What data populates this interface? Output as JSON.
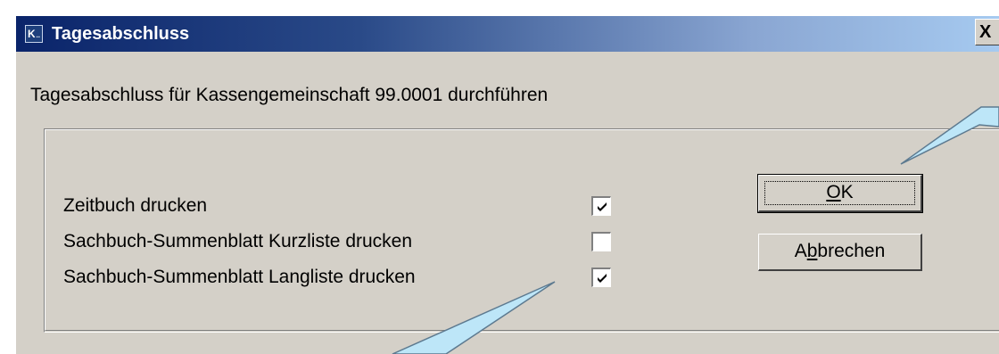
{
  "window": {
    "title": "Tagesabschluss",
    "close_label": "X",
    "icon": {
      "name": "app-icon",
      "glyph": "K",
      "subglyph": ".."
    }
  },
  "description": "Tagesabschluss für Kassengemeinschaft 99.0001 durchführen",
  "options": [
    {
      "label": "Zeitbuch drucken",
      "checked": true
    },
    {
      "label": "Sachbuch-Summenblatt Kurzliste drucken",
      "checked": false
    },
    {
      "label": "Sachbuch-Summenblatt Langliste drucken",
      "checked": true
    }
  ],
  "buttons": {
    "ok": {
      "label": "OK",
      "mnemonic": "O"
    },
    "cancel": {
      "label": "Abbrechen",
      "mnemonic": "b"
    }
  },
  "colors": {
    "titlebar_start": "#0a246a",
    "titlebar_end": "#a6caf0",
    "dialog_bg": "#d4d0c8",
    "callout_fill": "#bde6f8"
  }
}
